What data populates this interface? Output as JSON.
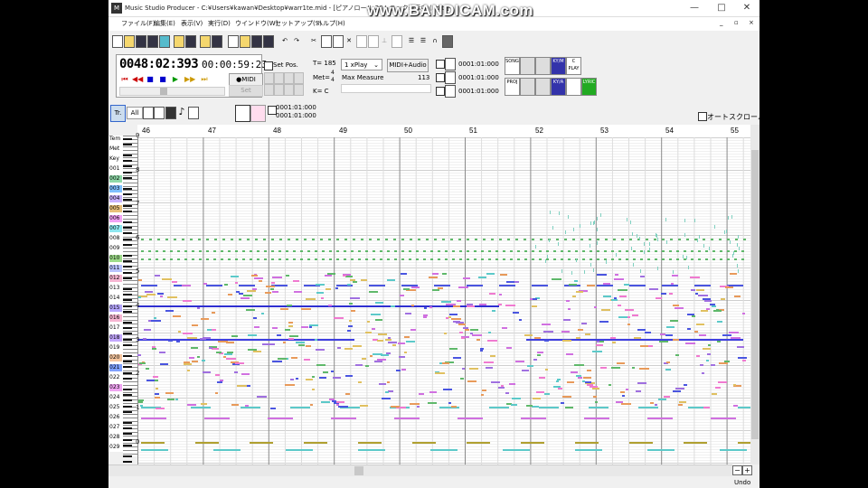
{
  "window": {
    "title": "Music Studio Producer - C:¥Users¥kawan¥Desktop¥warr1te.mid - [ピアノロール 20トラック表示中 (Edit)]",
    "minimize": "—",
    "maximize": "□",
    "close": "✕"
  },
  "watermark": "www.BANDICAM.com",
  "menu": {
    "items": [
      "ファイル(F)",
      "編集(E)",
      "表示(V)",
      "実行(D)",
      "ウインドウ(W)",
      "セットアップ(S)",
      "ヘルプ(H)"
    ],
    "inner_min": "_",
    "inner_restore": "▫",
    "inner_close": "×"
  },
  "transport": {
    "position": "0048:02:393",
    "clock": "00:00:59:23",
    "midi_label": "●MIDI",
    "set_label": "Set",
    "buttons": [
      "⏮",
      "◀◀",
      "■",
      "■",
      "▶",
      "▶▶",
      "⏭"
    ]
  },
  "setpos": {
    "label": "Set Pos."
  },
  "tempo": {
    "t_label": "T= 185",
    "met_label": "Met=",
    "met_num": "4",
    "met_den": "4",
    "key_label": "K= C"
  },
  "play": {
    "mode": "1 xPlay",
    "midi_audio": "MIDI+Audio",
    "max_measure_label": "Max Measure",
    "max_measure_value": "113"
  },
  "counters": [
    "0001:01:000",
    "0001:01:000",
    "0001:01:000"
  ],
  "modes": {
    "top": [
      "SONG",
      "",
      "",
      "KY/M",
      "C PLAY"
    ],
    "bottom": [
      "PROJ",
      "",
      "",
      "KY/A",
      "",
      "LYRIC"
    ]
  },
  "pianoroll": {
    "track_btn": "Tr.",
    "all_btn": "All",
    "pos_top": "0001:01:000",
    "pos_bottom": "0001:01:000",
    "autoscroll_label": "オートスクロール",
    "tracks": [
      "Tem",
      "Met",
      "Key",
      "001",
      "002",
      "003",
      "004",
      "005",
      "006",
      "007",
      "008",
      "009",
      "010",
      "011",
      "012",
      "013",
      "014",
      "015",
      "016",
      "017",
      "018",
      "019",
      "020",
      "021",
      "022",
      "023",
      "024",
      "025",
      "026",
      "027",
      "028",
      "029"
    ],
    "track_colors": [
      "#fff",
      "#fff",
      "#fff",
      "#fff",
      "#8fd9a8",
      "#7fc0ff",
      "#c9b3ff",
      "#e8c07a",
      "#f3a3f5",
      "#8fe7f0",
      "#fff",
      "#fff",
      "#9edc8a",
      "#b9c3ff",
      "#f7b6d2",
      "#fff",
      "#fff",
      "#b7a8ff",
      "#f7b6d2",
      "#fff",
      "#c4a8ff",
      "#fff",
      "#f7c7a0",
      "#7fa0ff",
      "#fff",
      "#f0a5f2",
      "#fff",
      "#fff",
      "#fff",
      "#fff",
      "#fff",
      "#fff"
    ],
    "bars": [
      "46",
      "47",
      "48",
      "49",
      "50",
      "51",
      "52",
      "53",
      "54",
      "55"
    ],
    "octaves": [
      "9",
      "8",
      "7",
      "6",
      "5",
      "4",
      "3",
      "2",
      "1",
      "0"
    ]
  },
  "status": {
    "undo": "Undo"
  }
}
